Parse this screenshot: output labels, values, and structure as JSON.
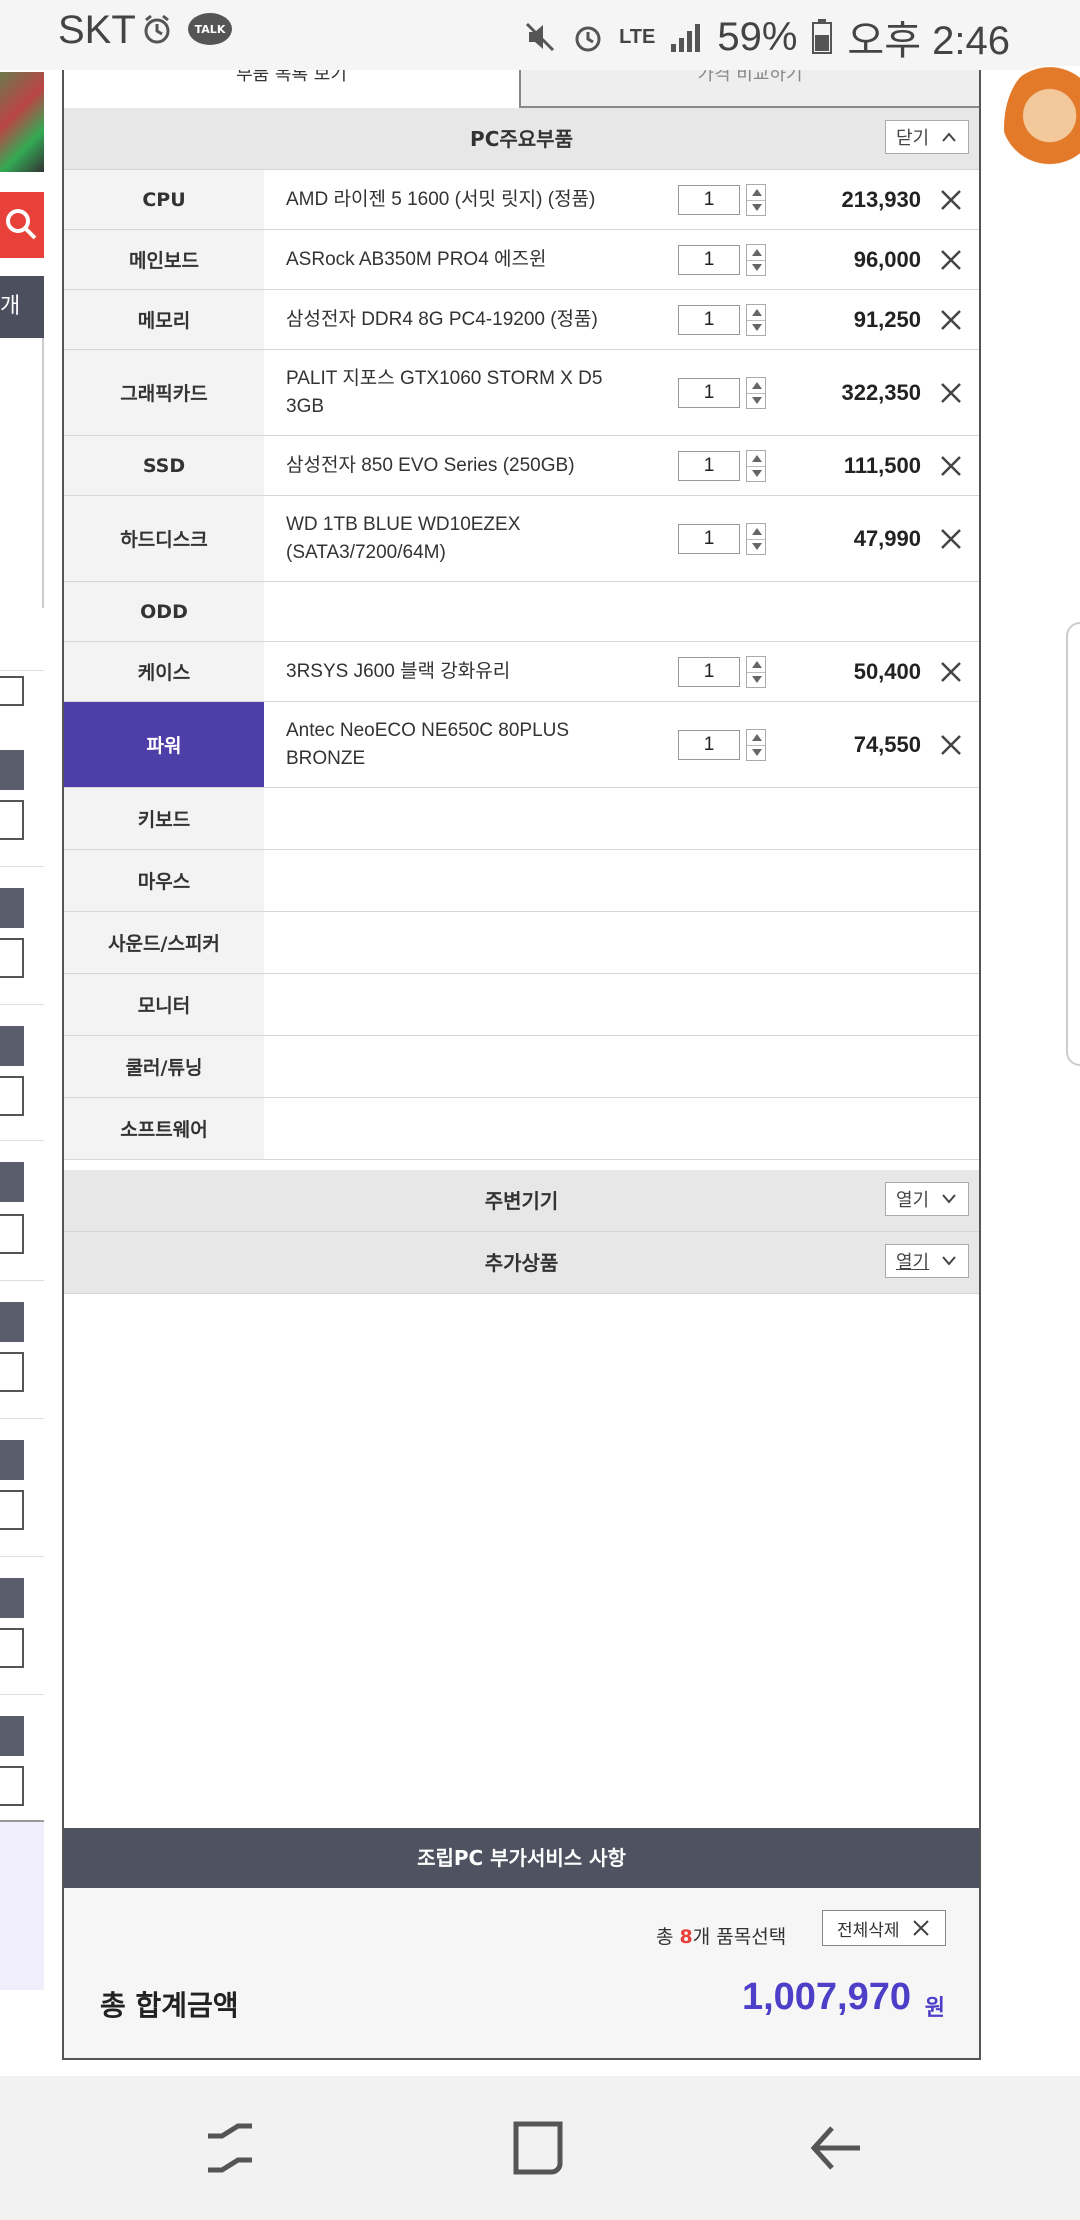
{
  "status_bar": {
    "carrier": "SKT",
    "network": "LTE",
    "battery": "59%",
    "time": "오후 2:46",
    "talk": "TALK"
  },
  "background": {
    "left_dark_label": "개"
  },
  "tabs": [
    {
      "label": "부품 목록 보기"
    },
    {
      "label": "가격 비교하기"
    }
  ],
  "main_section": {
    "title": "PC주요부품",
    "toggle_label": "닫기"
  },
  "parts": [
    {
      "category": "CPU",
      "name": "AMD 라이젠 5 1600 (서밋 릿지) (정품)",
      "qty": "1",
      "price": "213,930"
    },
    {
      "category": "메인보드",
      "name": "ASRock AB350M PRO4 에즈윈",
      "qty": "1",
      "price": "96,000"
    },
    {
      "category": "메모리",
      "name": "삼성전자 DDR4 8G PC4-19200 (정품)",
      "qty": "1",
      "price": "91,250"
    },
    {
      "category": "그래픽카드",
      "name": "PALIT 지포스 GTX1060 STORM X D5 3GB",
      "qty": "1",
      "price": "322,350"
    },
    {
      "category": "SSD",
      "name": "삼성전자 850 EVO Series (250GB)",
      "qty": "1",
      "price": "111,500"
    },
    {
      "category": "하드디스크",
      "name": "WD 1TB BLUE WD10EZEX (SATA3/7200/64M)",
      "qty": "1",
      "price": "47,990"
    },
    {
      "category": "ODD",
      "name": "",
      "qty": "",
      "price": ""
    },
    {
      "category": "케이스",
      "name": "3RSYS J600 블랙 강화유리",
      "qty": "1",
      "price": "50,400"
    },
    {
      "category": "파워",
      "name": "Antec NeoECO NE650C 80PLUS BRONZE",
      "qty": "1",
      "price": "74,550"
    },
    {
      "category": "키보드",
      "name": "",
      "qty": "",
      "price": ""
    },
    {
      "category": "마우스",
      "name": "",
      "qty": "",
      "price": ""
    },
    {
      "category": "사운드/스피커",
      "name": "",
      "qty": "",
      "price": ""
    },
    {
      "category": "모니터",
      "name": "",
      "qty": "",
      "price": ""
    },
    {
      "category": "쿨러/튜닝",
      "name": "",
      "qty": "",
      "price": ""
    },
    {
      "category": "소프트웨어",
      "name": "",
      "qty": "",
      "price": ""
    }
  ],
  "peripherals_section": {
    "title": "주변기기",
    "toggle_label": "열기"
  },
  "extra_section": {
    "title": "추가상품",
    "toggle_label": "열기"
  },
  "service": {
    "title": "조립PC 부가서비스 사항"
  },
  "summary": {
    "count_prefix": "총 ",
    "count": "8",
    "count_suffix": "개 품목선택",
    "clear_all_label": "전체삭제",
    "total_label": "총 합계금액",
    "total_amount": "1,007,970",
    "total_unit": "원"
  },
  "colors": {
    "accent": "#4e3fc8",
    "selected_category": "#4e3fa8",
    "service_bar": "#4f5260",
    "count_highlight": "#e8413a"
  }
}
